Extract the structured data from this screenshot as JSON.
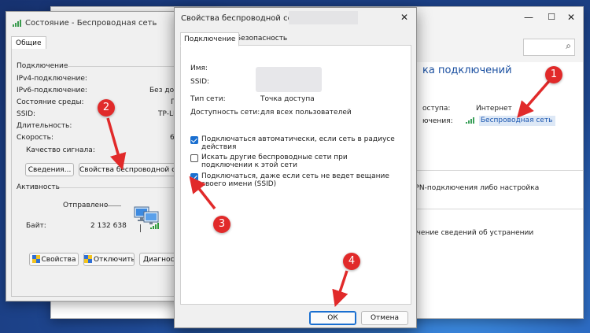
{
  "status_window": {
    "title": "Состояние - Беспроводная сеть",
    "tab": "Общие",
    "connection_group": "Подключение",
    "rows": [
      {
        "label": "IPv4-подключение:",
        "value": ""
      },
      {
        "label": "IPv6-подключение:",
        "value": "Без доступ"
      },
      {
        "label": "Состояние среды:",
        "value": "П"
      },
      {
        "label": "SSID:",
        "value": "TP-LI"
      },
      {
        "label": "Длительность:",
        "value": ""
      },
      {
        "label": "Скорость:",
        "value": "6"
      }
    ],
    "signal_quality_label": "Качество сигнала:",
    "details_button": "Сведения...",
    "wireless_props_button": "Свойства беспроводной сети",
    "activity_group": "Активность",
    "sent_label": "Отправлено",
    "bytes_label": "Байт:",
    "bytes_value": "2 132 638",
    "properties_button": "Свойства",
    "disable_button": "Отключить",
    "diagnose_button": "Диагност"
  },
  "dialog": {
    "title": "Свойства беспроводной сети",
    "close_glyph": "✕",
    "tabs": [
      "Подключение",
      "Безопасность"
    ],
    "name_label": "Имя:",
    "ssid_label": "SSID:",
    "network_type_label": "Тип сети:",
    "network_type_value": "Точка доступа",
    "availability_label": "Доступность сети:",
    "availability_value": "для всех пользователей",
    "options": [
      {
        "text": "Подключаться автоматически, если сеть в радиусе действия",
        "checked": true
      },
      {
        "text": "Искать другие беспроводные сети при подключении к этой сети",
        "checked": false
      },
      {
        "text": "Подключаться, даже если сеть не ведет вещание своего имени (SSID)",
        "checked": true
      }
    ],
    "ok_button": "ОК",
    "cancel_button": "Отмена"
  },
  "network_window": {
    "min_glyph": "—",
    "max_glyph": "☐",
    "close_glyph": "✕",
    "search_glyph": "⌕",
    "heading_fragment": "ка подключений",
    "access_label_fragment": "оступа:",
    "access_value": "Интернет",
    "connections_label_fragment": "ючения:",
    "connection_link": "Беспроводная сеть",
    "vpn_text_fragment": "я VPN-подключения либо настройка",
    "troubleshoot_text_fragment": "олучение сведений об устранении"
  },
  "annotations": {
    "badges": [
      "1",
      "2",
      "3",
      "4"
    ],
    "color": "#e12a2a"
  },
  "colors": {
    "accent": "#1a6fd0",
    "link": "#1a56b0",
    "signal_green": "#3aa05a"
  }
}
